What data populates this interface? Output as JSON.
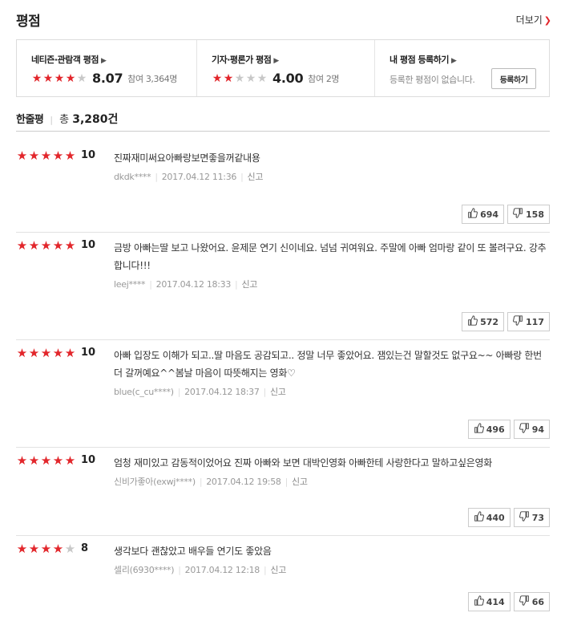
{
  "header": {
    "title": "평점",
    "more_label": "더보기"
  },
  "summary": {
    "netizen": {
      "title": "네티즌·관람객 평점",
      "stars_filled": 4,
      "stars_total": 5,
      "score": "8.07",
      "participants": "참여 3,364명"
    },
    "critic": {
      "title": "기자·평론가 평점",
      "stars_filled": 2,
      "stars_total": 5,
      "score": "4.00",
      "participants": "참여 2명"
    },
    "mine": {
      "title": "내 평점 등록하기",
      "empty_text": "등록한 평점이 없습니다.",
      "button_label": "등록하기"
    }
  },
  "comments": {
    "label": "한줄평",
    "count_prefix": "총",
    "count_value": "3,280건"
  },
  "reviews": [
    {
      "stars_filled": 5,
      "score": "10",
      "text": "진짜재미써요아빠랑보면좋을꺼같내용",
      "author": "dkdk****",
      "date": "2017.04.12 11:36",
      "report": "신고",
      "likes": "694",
      "dislikes": "158"
    },
    {
      "stars_filled": 5,
      "score": "10",
      "text": "금방 아빠는딸 보고 나왔어요. 윤제문 연기 신이네요. 넘넘 귀여워요. 주말에 아빠 엄마랑 같이 또 볼려구요. 강추합니다!!!",
      "author": "leej****",
      "date": "2017.04.12 18:33",
      "report": "신고",
      "likes": "572",
      "dislikes": "117"
    },
    {
      "stars_filled": 5,
      "score": "10",
      "text": "아빠 입장도 이해가 되고..딸 마음도 공감되고.. 정말 너무 좋았어요. 잼있는건 말할것도 없구요~~ 아빠랑 한번 더 갈꺼예요^^봄날 마음이 따뜻해지는 영화♡",
      "author": "blue(c_cu****)",
      "date": "2017.04.12 18:37",
      "report": "신고",
      "likes": "496",
      "dislikes": "94"
    },
    {
      "stars_filled": 5,
      "score": "10",
      "text": "엄청 재미있고 감동적이었어요 진짜 아빠와 보면 대박인영화 아빠한테 사랑한다고 말하고싶은영화",
      "author": "신비가좋아(exwj****)",
      "date": "2017.04.12 19:58",
      "report": "신고",
      "likes": "440",
      "dislikes": "73"
    },
    {
      "stars_filled": 4,
      "score": "8",
      "text": "생각보다 괜찮았고 배우들 연기도 좋았음",
      "author": "셀리(6930****)",
      "date": "2017.04.12 12:18",
      "report": "신고",
      "likes": "414",
      "dislikes": "66"
    }
  ],
  "colors": {
    "accent": "#e2262b",
    "star_off": "#c8c8c8"
  }
}
